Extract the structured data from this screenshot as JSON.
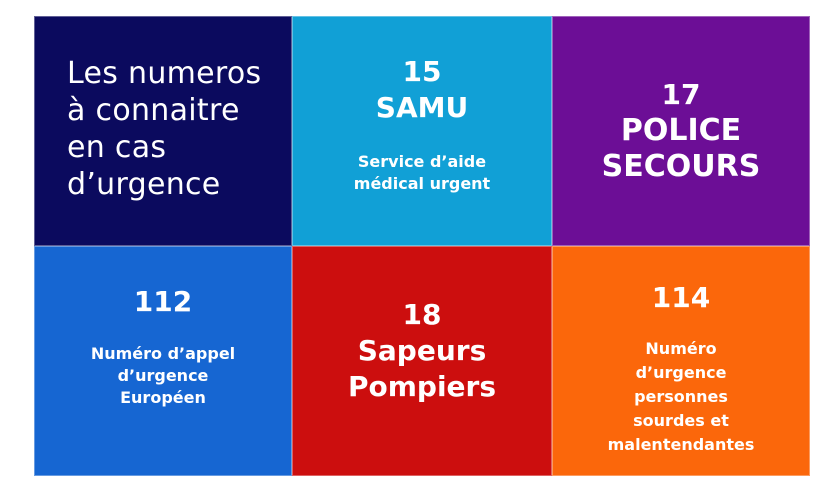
{
  "colors": {
    "navy": "#0b0a5e",
    "cyan": "#11a0d6",
    "purple": "#6c0e96",
    "blue": "#1666d2",
    "red": "#cc0e0e",
    "orange": "#fb670b"
  },
  "title": {
    "lines": [
      "Les numeros",
      "à connaitre",
      "en cas",
      "d’urgence"
    ]
  },
  "samu": {
    "number": "15",
    "name": "SAMU",
    "desc_lines": [
      "Service d’aide",
      "médical urgent"
    ]
  },
  "police": {
    "number": "17",
    "name_lines": [
      "POLICE",
      "SECOURS"
    ]
  },
  "europe": {
    "number": "112",
    "desc_lines": [
      "Numéro d’appel",
      "d’urgence",
      "Européen"
    ]
  },
  "pompiers": {
    "number": "18",
    "name_lines": [
      "Sapeurs",
      "Pompiers"
    ]
  },
  "sourds": {
    "number": "114",
    "desc_lines": [
      "Numéro",
      "d’urgence",
      "personnes",
      "sourdes et",
      "malentendantes"
    ]
  }
}
